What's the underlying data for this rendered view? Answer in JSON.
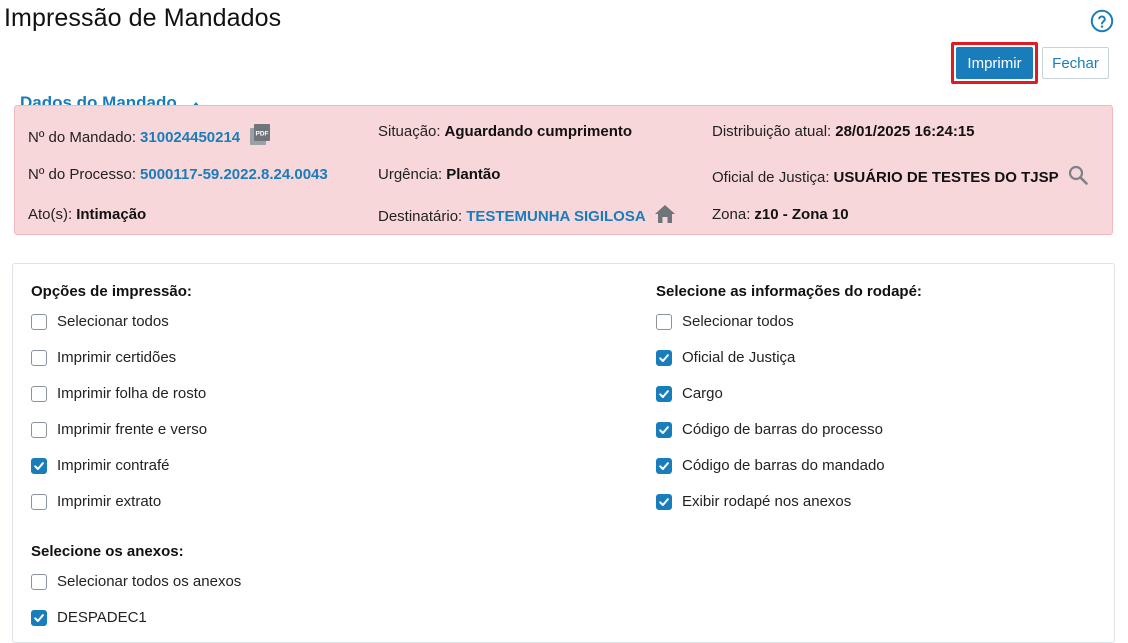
{
  "page": {
    "title": "Impressão de Mandados",
    "help_icon": "help-circle-icon"
  },
  "actions": {
    "print_label": "Imprimir",
    "close_label": "Fechar"
  },
  "mandado": {
    "section_title": "Dados do Mandado",
    "numero_label": "Nº do Mandado:",
    "numero_value": "310024450214",
    "situacao_label": "Situação:",
    "situacao_value": "Aguardando cumprimento",
    "distribuicao_label": "Distribuição atual:",
    "distribuicao_value": "28/01/2025 16:24:15",
    "processo_label": "Nº do Processo:",
    "processo_value": "5000117-59.2022.8.24.0043",
    "urgencia_label": "Urgência:",
    "urgencia_value": "Plantão",
    "oficial_label": "Oficial de Justiça:",
    "oficial_value": "USUÁRIO DE TESTES DO TJSP",
    "atos_label": "Ato(s):",
    "atos_value": "Intimação",
    "destinatario_label": "Destinatário:",
    "destinatario_value": "TESTEMUNHA SIGILOSA",
    "zona_label": "Zona:",
    "zona_value": "z10 - Zona 10",
    "icons": [
      "pdf-icon",
      "search-icon",
      "home-icon"
    ],
    "box_color": "#f8d7da"
  },
  "print_options": {
    "title": "Opções de impressão:",
    "items": [
      {
        "label": "Selecionar todos",
        "checked": false
      },
      {
        "label": "Imprimir certidões",
        "checked": false
      },
      {
        "label": "Imprimir folha de rosto",
        "checked": false
      },
      {
        "label": "Imprimir frente e verso",
        "checked": false
      },
      {
        "label": "Imprimir contrafé",
        "checked": true
      },
      {
        "label": "Imprimir extrato",
        "checked": false
      }
    ]
  },
  "footer_options": {
    "title": "Selecione as informações do rodapé:",
    "items": [
      {
        "label": "Selecionar todos",
        "checked": false
      },
      {
        "label": "Oficial de Justiça",
        "checked": true
      },
      {
        "label": "Cargo",
        "checked": true
      },
      {
        "label": "Código de barras do processo",
        "checked": true
      },
      {
        "label": "Código de barras do mandado",
        "checked": true
      },
      {
        "label": "Exibir rodapé nos anexos",
        "checked": true
      }
    ]
  },
  "attachments": {
    "title": "Selecione os anexos:",
    "items": [
      {
        "label": "Selecionar todos os anexos",
        "checked": false
      },
      {
        "label": "DESPADEC1",
        "checked": true
      }
    ]
  },
  "colors": {
    "accent": "#1a7dbb",
    "highlight": "#e01b24"
  }
}
